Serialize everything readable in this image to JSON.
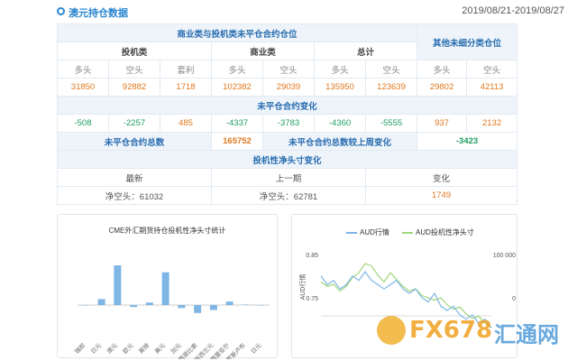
{
  "header": {
    "title": "澳元持仓数据",
    "date_range": "2019/08/21-2019/08/27"
  },
  "table": {
    "section1_title": "商业类与投机类未平仓合约仓位",
    "other_title": "其他未细分类仓位",
    "group_spec": "投机类",
    "group_comm": "商业类",
    "group_total": "总计",
    "col_long": "多头",
    "col_short": "空头",
    "col_spread": "套利",
    "row1": [
      "31850",
      "92882",
      "1718",
      "102382",
      "29039",
      "135950",
      "123639",
      "29802",
      "42113"
    ],
    "section2_title": "未平仓合约变化",
    "row2": [
      "-508",
      "-2257",
      "485",
      "-4337",
      "-3783",
      "-4360",
      "-5555",
      "937",
      "2132"
    ],
    "total_label": "未平仓合约总数",
    "total_value": "165752",
    "change_label": "未平仓合约总数较上周变化",
    "change_value": "-3423",
    "section3_title": "投机性净头寸变化",
    "col_latest": "最新",
    "col_prev": "上一期",
    "col_change": "变化",
    "latest": "净空头：61032",
    "prev": "净空头：62781",
    "delta": "1749"
  },
  "chart_data": [
    {
      "type": "bar",
      "title": "CME外汇期货持仓投机性净头寸统计",
      "categories": [
        "瑞郎",
        "日元",
        "澳元",
        "欧元",
        "英镑",
        "美元",
        "加元",
        "墨西哥比索",
        "新西兰元",
        "巴西雷亚尔",
        "俄罗斯卢布",
        "日元"
      ],
      "values": [
        0,
        12,
        80,
        -4,
        5,
        66,
        -6,
        -16,
        -10,
        7,
        1,
        0
      ],
      "color": "#7fb6e6"
    },
    {
      "type": "line",
      "legend": [
        "AUD行情",
        "AUD投机性净头寸"
      ],
      "ylabel": "AUD行情",
      "y_ticks_left": [
        "0.85",
        "0.75"
      ],
      "y_ticks_right": [
        "100 000",
        "0"
      ],
      "colors": [
        "#7fb6e6",
        "#9fd67a"
      ],
      "series": [
        {
          "name": "AUD行情",
          "values": [
            0.8,
            0.78,
            0.79,
            0.77,
            0.78,
            0.8,
            0.79,
            0.81,
            0.79,
            0.78,
            0.77,
            0.78,
            0.79,
            0.77,
            0.76,
            0.77,
            0.75,
            0.74,
            0.76,
            0.73,
            0.72,
            0.73,
            0.71,
            0.7,
            0.71,
            0.69,
            0.7,
            0.68
          ]
        },
        {
          "name": "AUD投机性净头寸",
          "values": [
            40000,
            30000,
            35000,
            20000,
            30000,
            50000,
            60000,
            80000,
            75000,
            55000,
            40000,
            60000,
            45000,
            30000,
            20000,
            25000,
            10000,
            5000,
            0,
            5000,
            -10000,
            -20000,
            -15000,
            -30000,
            -40000,
            -35000,
            -50000,
            -60000
          ]
        }
      ]
    }
  ],
  "watermark": {
    "logo_text": "FX678",
    "logo_cn": "汇通网"
  }
}
